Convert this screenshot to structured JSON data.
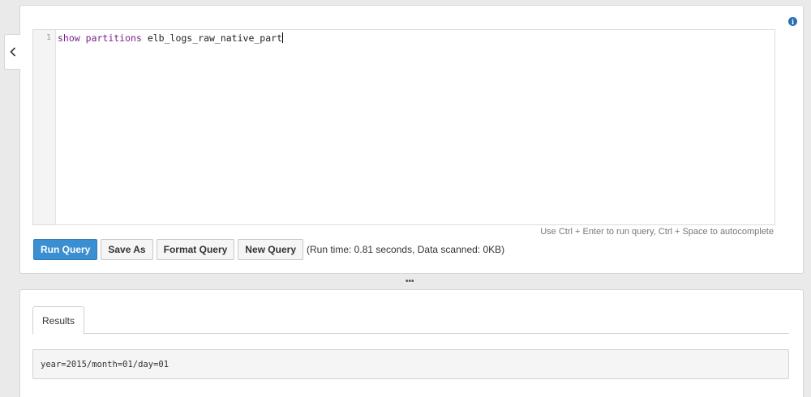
{
  "editor": {
    "line_number": "1",
    "keyword_show": "show",
    "keyword_partitions": "partitions",
    "table_name": "elb_logs_raw_native_part"
  },
  "hint_text": "Use Ctrl + Enter to run query, Ctrl + Space to autocomplete",
  "toolbar": {
    "run_label": "Run Query",
    "save_as_label": "Save As",
    "format_label": "Format Query",
    "new_label": "New Query",
    "run_status": "(Run time: 0.81 seconds, Data scanned: 0KB)"
  },
  "splitter_glyph": "•••",
  "results": {
    "tab_label": "Results",
    "row_text": "year=2015/month=01/day=01"
  },
  "icons": {
    "collapse": "chevron-left-icon",
    "info": "info-icon"
  },
  "colors": {
    "primary_button": "#3a8fd2",
    "keyword": "#7a1e8a",
    "info_icon": "#2a6db5"
  }
}
